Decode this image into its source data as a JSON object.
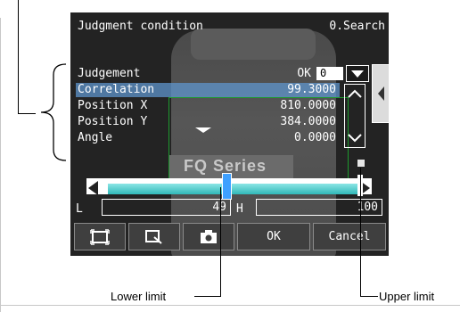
{
  "header": {
    "title": "Judgment condition",
    "mode": "0.Search"
  },
  "params": [
    {
      "label": "Judgement",
      "value": "OK"
    },
    {
      "label": "Correlation",
      "value": "99.3000"
    },
    {
      "label": "Position X",
      "value": "810.0000"
    },
    {
      "label": "Position Y",
      "value": "384.0000"
    },
    {
      "label": "Angle",
      "value": "0.0000"
    }
  ],
  "judgement_select": {
    "value": "0"
  },
  "photo": {
    "text": "FQ Series"
  },
  "limits": {
    "lower_label": "L",
    "lower_value": "49",
    "upper_label": "H",
    "upper_value": "100",
    "range_max": 100
  },
  "buttons": {
    "ok": "OK",
    "cancel": "Cancel"
  },
  "annotations": {
    "lower": "Lower limit",
    "upper": "Upper limit"
  },
  "colors": {
    "selected_row": "#5f96cd",
    "slider_fill": "#31b8b8",
    "thumb": "#3ea0ff",
    "roi": "#1e9a2e"
  }
}
